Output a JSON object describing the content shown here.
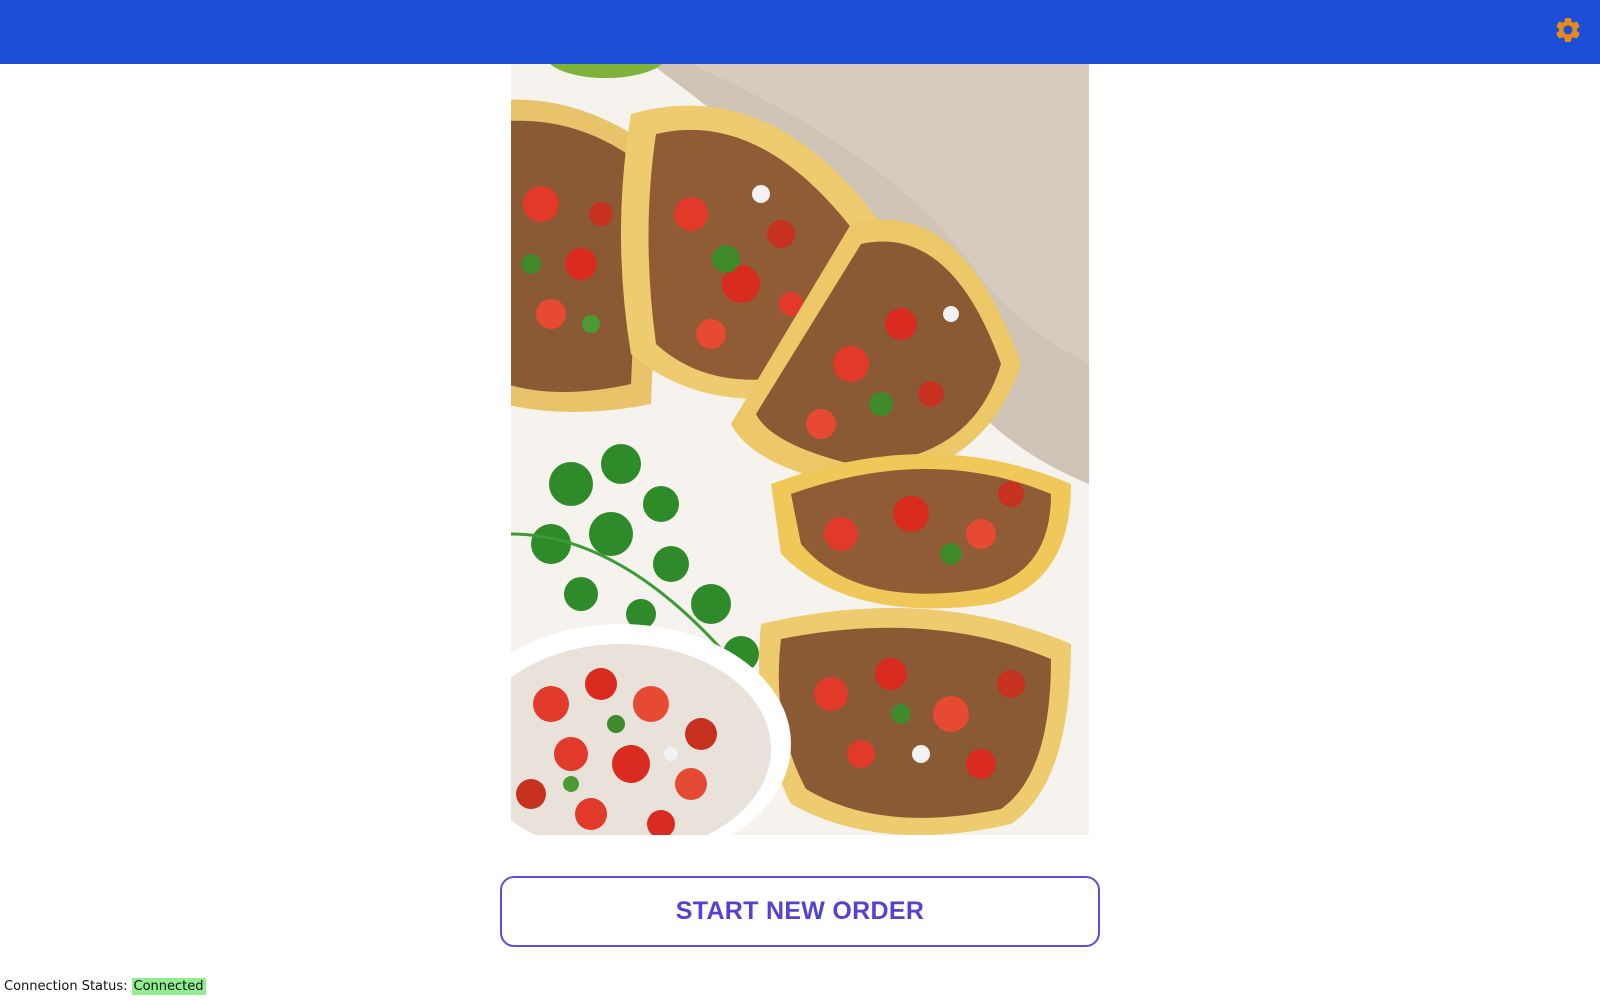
{
  "header": {
    "settings_icon": "gear-icon",
    "bar_color": "#1d4ed8",
    "icon_color": "#e8891c"
  },
  "hero": {
    "alt": "Street tacos with steak and pico de gallo"
  },
  "actions": {
    "start_label": "START NEW ORDER",
    "accent_color": "#5343d1"
  },
  "footer": {
    "status_label": "Connection Status:",
    "status_value": "Connected",
    "status_color": "#90ee90"
  }
}
